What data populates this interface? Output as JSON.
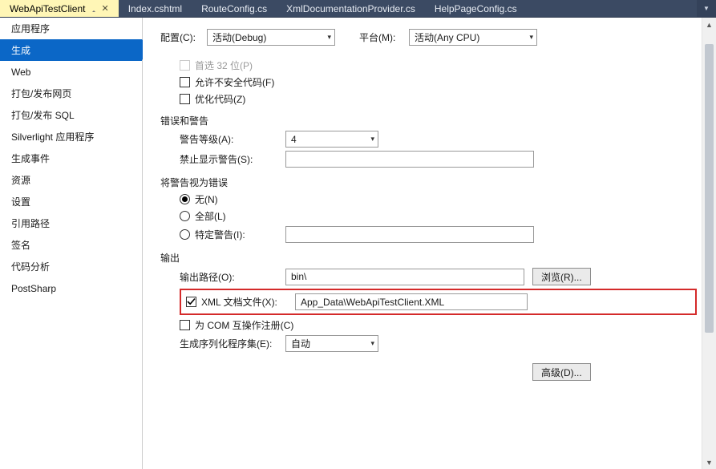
{
  "tabs": [
    {
      "label": "WebApiTestClient",
      "active": true
    },
    {
      "label": "Index.cshtml",
      "active": false
    },
    {
      "label": "RouteConfig.cs",
      "active": false
    },
    {
      "label": "XmlDocumentationProvider.cs",
      "active": false
    },
    {
      "label": "HelpPageConfig.cs",
      "active": false
    }
  ],
  "sidebar": {
    "items": [
      "应用程序",
      "生成",
      "Web",
      "打包/发布网页",
      "打包/发布 SQL",
      "Silverlight 应用程序",
      "生成事件",
      "资源",
      "设置",
      "引用路径",
      "签名",
      "代码分析",
      "PostSharp"
    ],
    "activeIndex": 1
  },
  "top": {
    "config_label": "配置(C):",
    "config_value": "活动(Debug)",
    "platform_label": "平台(M):",
    "platform_value": "活动(Any CPU)"
  },
  "general": {
    "prefer32_label": "首选 32 位(P)",
    "allow_unsafe_label": "允许不安全代码(F)",
    "optimize_label": "优化代码(Z)",
    "prefer32_checked": false,
    "allow_unsafe_checked": false,
    "optimize_checked": false
  },
  "errors_section": {
    "title": "错误和警告",
    "warning_level_label": "警告等级(A):",
    "warning_level_value": "4",
    "suppress_label": "禁止显示警告(S):",
    "suppress_value": ""
  },
  "treat_section": {
    "title": "将警告视为错误",
    "none_label": "无(N)",
    "all_label": "全部(L)",
    "specific_label": "特定警告(I):",
    "selected": "none",
    "specific_value": ""
  },
  "output_section": {
    "title": "输出",
    "path_label": "输出路径(O):",
    "path_value": "bin\\",
    "browse_label": "浏览(R)...",
    "xml_checked": true,
    "xml_label": "XML 文档文件(X):",
    "xml_value": "App_Data\\WebApiTestClient.XML",
    "com_label": "为 COM 互操作注册(C)",
    "com_checked": false,
    "serial_label": "生成序列化程序集(E):",
    "serial_value": "自动",
    "advanced_label": "高级(D)..."
  }
}
